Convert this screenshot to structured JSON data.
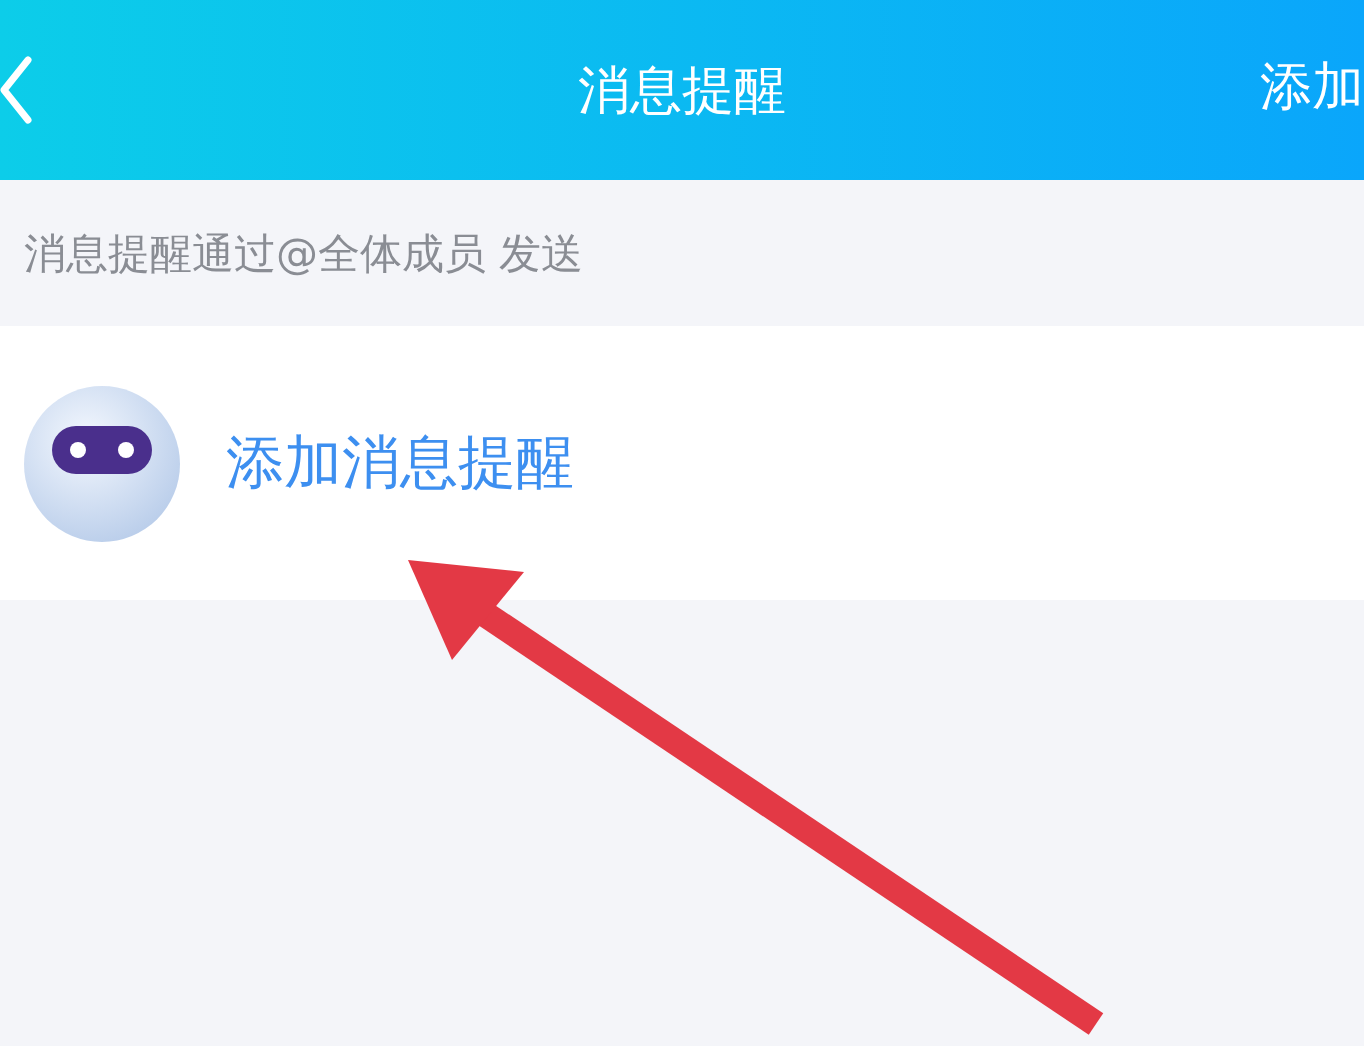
{
  "header": {
    "title": "消息提醒",
    "action": "添加"
  },
  "hint": "消息提醒通过@全体成员 发送",
  "items": [
    {
      "label": "添加消息提醒"
    }
  ]
}
